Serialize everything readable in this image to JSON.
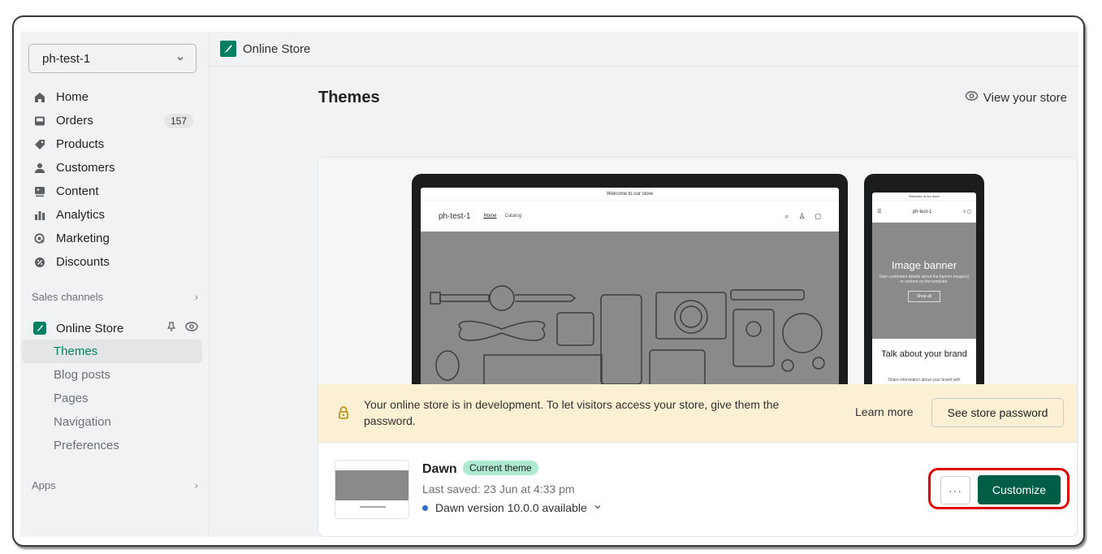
{
  "sidebar": {
    "store_name": "ph-test-1",
    "items": [
      {
        "label": "Home",
        "icon": "home-icon"
      },
      {
        "label": "Orders",
        "icon": "inbox-icon",
        "badge": "157"
      },
      {
        "label": "Products",
        "icon": "tag-icon"
      },
      {
        "label": "Customers",
        "icon": "person-icon"
      },
      {
        "label": "Content",
        "icon": "image-icon"
      },
      {
        "label": "Analytics",
        "icon": "bar-chart-icon"
      },
      {
        "label": "Marketing",
        "icon": "target-icon"
      },
      {
        "label": "Discounts",
        "icon": "discount-icon"
      }
    ],
    "sales_channels_label": "Sales channels",
    "online_store_label": "Online Store",
    "sub_items": [
      {
        "label": "Themes",
        "active": true
      },
      {
        "label": "Blog posts"
      },
      {
        "label": "Pages"
      },
      {
        "label": "Navigation"
      },
      {
        "label": "Preferences"
      }
    ],
    "apps_label": "Apps"
  },
  "topbar": {
    "title": "Online Store"
  },
  "main": {
    "page_title": "Themes",
    "view_store_label": "View your store",
    "preview": {
      "announcement": "Welcome to our store",
      "store_name": "ph-test-1",
      "nav_links": [
        "Home",
        "Catalog"
      ],
      "banner_heading": "Image banner",
      "banner_text": "Give customers details about the banner image(s) or content on the template.",
      "banner_button": "Shop all",
      "talk_heading": "Talk about your brand",
      "talk_text": "Share information about your brand with"
    },
    "notice": {
      "message": "Your online store is in development. To let visitors access your store, give them the password.",
      "learn_more": "Learn more",
      "password_button": "See store password"
    },
    "theme": {
      "name": "Dawn",
      "badge": "Current theme",
      "last_saved": "Last saved: 23 Jun at 4:33 pm",
      "version": "Dawn version 10.0.0 available",
      "more_label": "···",
      "customize_label": "Customize"
    }
  },
  "colors": {
    "brand": "#008060",
    "customize_button": "#005e46",
    "badge_bg": "#aee9d1",
    "notice_bg": "#fcf0d4",
    "highlight": "#e00000",
    "version_dot": "#2c6ecb"
  }
}
